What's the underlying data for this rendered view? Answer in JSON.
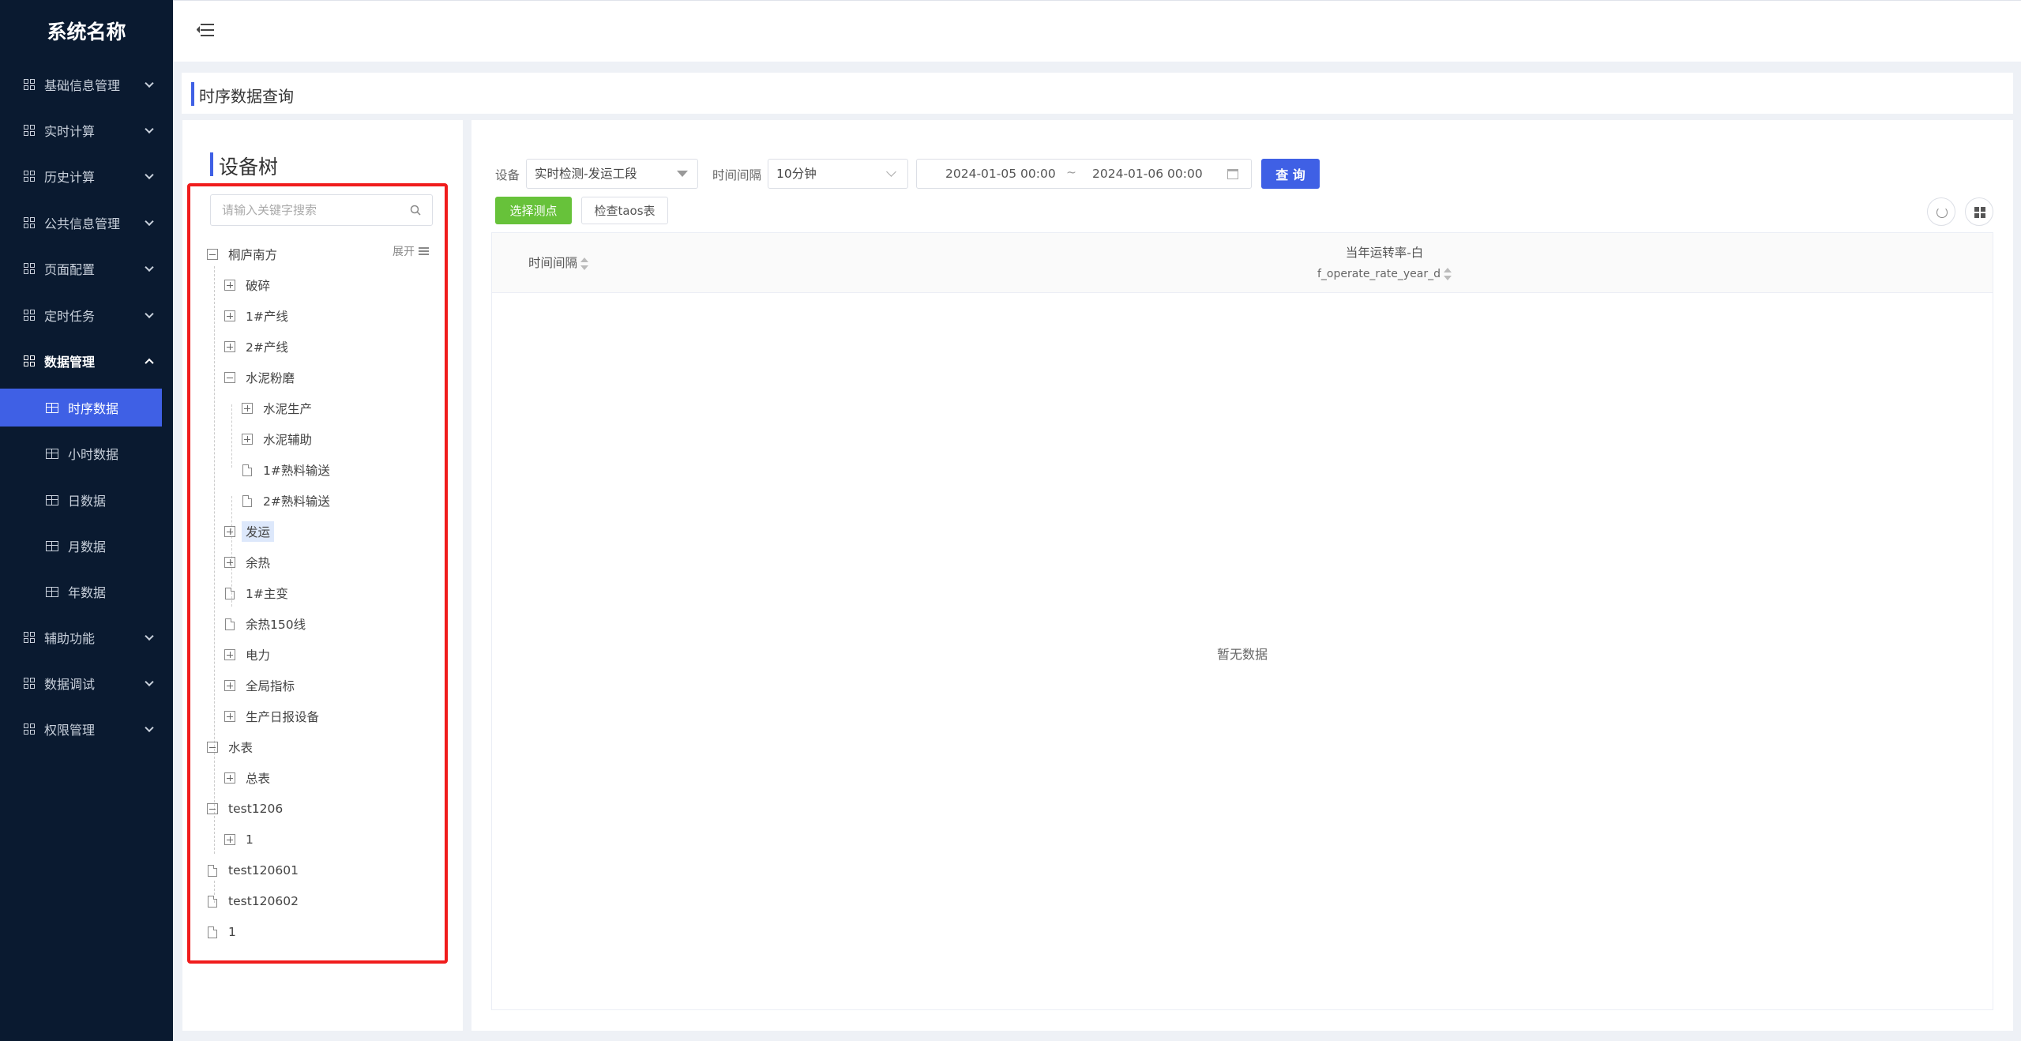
{
  "app": {
    "title": "系统名称"
  },
  "sidebar": {
    "menu": [
      {
        "label": "基础信息管理"
      },
      {
        "label": "实时计算"
      },
      {
        "label": "历史计算"
      },
      {
        "label": "公共信息管理"
      },
      {
        "label": "页面配置"
      },
      {
        "label": "定时任务"
      },
      {
        "label": "数据管理",
        "expanded": true
      },
      {
        "label": "辅助功能"
      },
      {
        "label": "数据调试"
      },
      {
        "label": "权限管理"
      }
    ],
    "data_submenu": [
      {
        "label": "时序数据",
        "active": true
      },
      {
        "label": "小时数据"
      },
      {
        "label": "日数据"
      },
      {
        "label": "月数据"
      },
      {
        "label": "年数据"
      }
    ]
  },
  "breadcrumb": {
    "title": "时序数据查询"
  },
  "tree": {
    "title": "设备树",
    "search_placeholder": "请输入关键字搜索",
    "expand_label": "展开",
    "nodes": [
      {
        "label": "桐庐南方",
        "type": "minus"
      },
      {
        "label": "破碎",
        "type": "plus"
      },
      {
        "label": "1#产线",
        "type": "plus"
      },
      {
        "label": "2#产线",
        "type": "plus"
      },
      {
        "label": "水泥粉磨",
        "type": "minus"
      },
      {
        "label": "水泥生产",
        "type": "plus"
      },
      {
        "label": "水泥辅助",
        "type": "plus"
      },
      {
        "label": "1#熟料输送",
        "type": "file"
      },
      {
        "label": "2#熟料输送",
        "type": "file"
      },
      {
        "label": "发运",
        "type": "plus",
        "selected": true
      },
      {
        "label": "余热",
        "type": "plus"
      },
      {
        "label": "1#主变",
        "type": "file"
      },
      {
        "label": "余热150线",
        "type": "file"
      },
      {
        "label": "电力",
        "type": "plus"
      },
      {
        "label": "全局指标",
        "type": "plus"
      },
      {
        "label": "生产日报设备",
        "type": "plus"
      },
      {
        "label": "水表",
        "type": "minus"
      },
      {
        "label": "总表",
        "type": "plus"
      },
      {
        "label": "test1206",
        "type": "minus"
      },
      {
        "label": "1",
        "type": "plus"
      },
      {
        "label": "test120601",
        "type": "file"
      },
      {
        "label": "test120602",
        "type": "file"
      },
      {
        "label": "1",
        "type": "file"
      }
    ]
  },
  "filters": {
    "device_label": "设备",
    "device_value": "实时检测-发运工段",
    "interval_label": "时间间隔",
    "interval_value": "10分钟",
    "date_start": "2024-01-05  00:00",
    "date_separator": "~",
    "date_end": "2024-01-06  00:00",
    "query_label": "查 询"
  },
  "actions": {
    "select_points": "选择测点",
    "check_taos": "检查taos表"
  },
  "table": {
    "columns": [
      {
        "label": "时间间隔"
      },
      {
        "label": "当年运转率-白",
        "sub": "f_operate_rate_year_d"
      }
    ],
    "empty_text": "暂无数据"
  }
}
